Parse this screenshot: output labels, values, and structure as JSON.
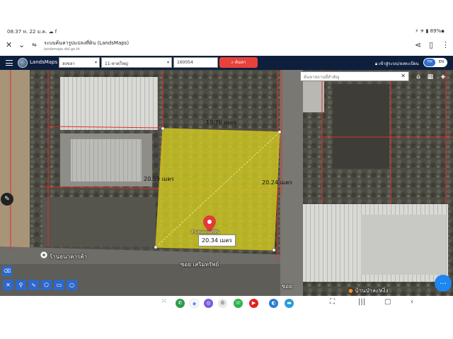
{
  "status_bar": {
    "time_date": "08:37 ท. 22 ม.ค.",
    "icons_left": "☁ f",
    "battery": "⚡ ✈ ▮ 89%▪"
  },
  "browser": {
    "title": "ระบบค้นหารูปแปลงที่ดิน (LandsMaps)",
    "url": "landsmaps.dol.go.th"
  },
  "app": {
    "brand": "LandsMaps",
    "province": "สงขลา",
    "district": "11-หาดใหญ่",
    "parcel_number": "160054",
    "search_label": "ค้นหา",
    "login_label": "เข้าสู่ระบบ/ลงทะเบียน",
    "lang_th": "TH",
    "lang_en": "EN"
  },
  "map": {
    "place_search_placeholder": "ค้นหาสถานที่สำคัญ",
    "dim_top": "19.76 เมตร",
    "dim_left": "20.59 เมตร",
    "dim_right": "20.24 เมตร",
    "dim_bottom": "20.34 เมตร",
    "marker_label": "ตำแหน่งแปลงที่ดิน",
    "poi_left": "ร้านธนาคารค้า",
    "poi_right": "บ้านป่าละหงิ่ง",
    "street_label": "ซอย เสริมทรัพย์",
    "street_label_side": "ซอย",
    "parcel_color": "#d6d020",
    "boundary_color": "#e0302a"
  }
}
